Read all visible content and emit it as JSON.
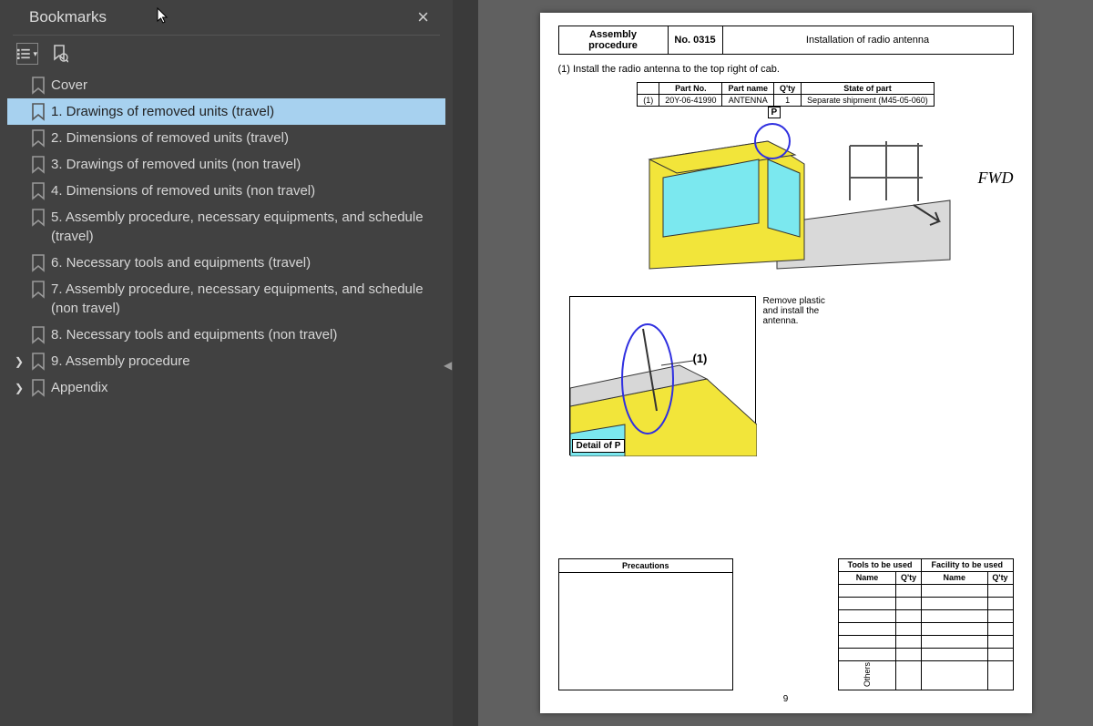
{
  "sidebar": {
    "title": "Bookmarks",
    "items": [
      {
        "label": "Cover",
        "expandable": false,
        "selected": false
      },
      {
        "label": "1. Drawings of removed units (travel)",
        "expandable": false,
        "selected": true
      },
      {
        "label": "2. Dimensions of removed units (travel)",
        "expandable": false,
        "selected": false
      },
      {
        "label": "3. Drawings of removed units (non travel)",
        "expandable": false,
        "selected": false
      },
      {
        "label": "4. Dimensions of removed units (non travel)",
        "expandable": false,
        "selected": false
      },
      {
        "label": "5. Assembly procedure, necessary equipments, and schedule (travel)",
        "expandable": false,
        "selected": false
      },
      {
        "label": "6. Necessary tools and equipments (travel)",
        "expandable": false,
        "selected": false
      },
      {
        "label": "7. Assembly procedure, necessary equipments, and schedule (non travel)",
        "expandable": false,
        "selected": false
      },
      {
        "label": "8. Necessary tools and equipments (non travel)",
        "expandable": false,
        "selected": false
      },
      {
        "label": "9. Assembly procedure",
        "expandable": true,
        "selected": false
      },
      {
        "label": "Appendix",
        "expandable": true,
        "selected": false
      }
    ]
  },
  "doc": {
    "header": {
      "col1_label": "Assembly procedure",
      "col2_label": "No. 0315",
      "col3_label": "Installation of radio antenna"
    },
    "step_text": "(1)  Install the radio antenna to the top right of cab.",
    "parts_header": {
      "c1": "Part No.",
      "c2": "Part name",
      "c3": "Q'ty",
      "c4": "State of part"
    },
    "parts_row": {
      "idx": "(1)",
      "c1": "20Y-06-41990",
      "c2": "ANTENNA",
      "c3": "1",
      "c4": "Separate shipment (M45-05-060)"
    },
    "p_marker": "P",
    "fwd_text": "FWD",
    "detail_callout": "(1)",
    "detail_caption": "Remove plastic and install the antenna.",
    "detail_label": "Detail of P",
    "precautions_label": "Precautions",
    "tools_header": "Tools to be used",
    "facility_header": "Facility to be used",
    "name_label": "Name",
    "qty_label": "Q'ty",
    "others_label": "Others",
    "page_number": "9"
  }
}
